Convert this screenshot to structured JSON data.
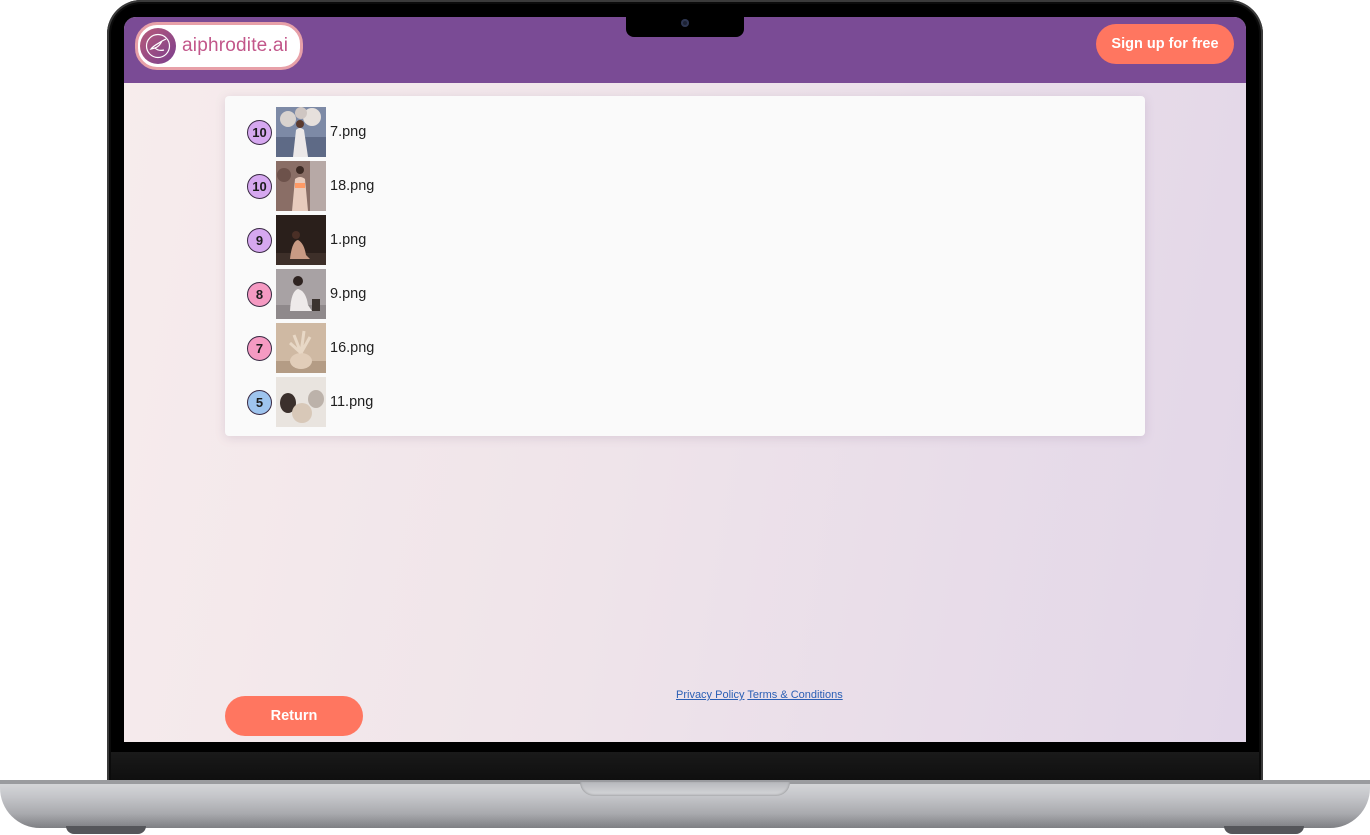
{
  "header": {
    "logo_text": "aiphrodite.ai",
    "signup_label": "Sign up for free"
  },
  "results": [
    {
      "rank": "10",
      "file": "7.png",
      "badge_color": "#d6a8f0",
      "thumb": "portrait-flowers"
    },
    {
      "rank": "10",
      "file": "18.png",
      "badge_color": "#d6a8f0",
      "thumb": "portrait-gown"
    },
    {
      "rank": "9",
      "file": "1.png",
      "badge_color": "#d6a8f0",
      "thumb": "portrait-seated-dark"
    },
    {
      "rank": "8",
      "file": "9.png",
      "badge_color": "#f59ac2",
      "thumb": "portrait-crouch"
    },
    {
      "rank": "7",
      "file": "16.png",
      "badge_color": "#f59ac2",
      "thumb": "vase-dried-flowers"
    },
    {
      "rank": "5",
      "file": "11.png",
      "badge_color": "#9ec4ee",
      "thumb": "ceramic-vases"
    }
  ],
  "footer": {
    "privacy_label": "Privacy Policy",
    "terms_label": "Terms & Conditions"
  },
  "return_label": "Return"
}
